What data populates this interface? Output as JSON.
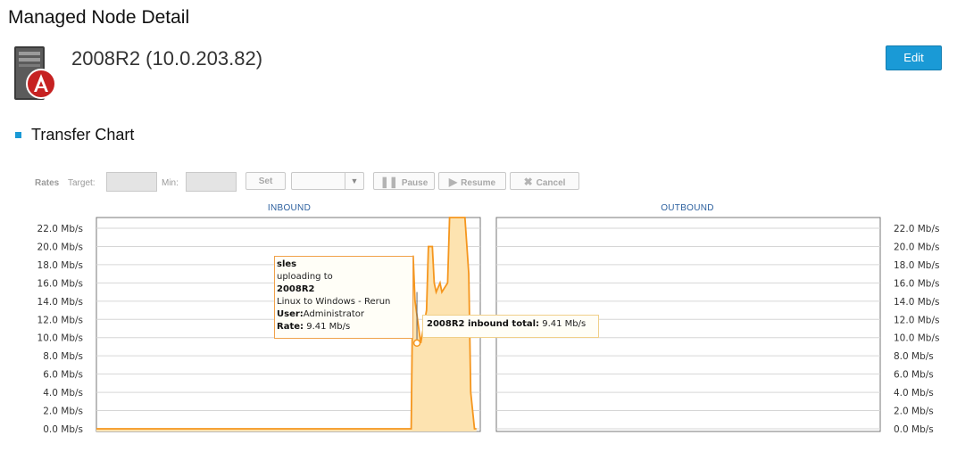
{
  "page": {
    "title": "Managed Node Detail"
  },
  "node": {
    "title": "2008R2 (10.0.203.82)",
    "icon": "server-node-icon"
  },
  "header": {
    "edit_label": "Edit"
  },
  "section": {
    "title": "Transfer Chart"
  },
  "toolbar": {
    "rates_label": "Rates",
    "target_label": "Target:",
    "target_value": "",
    "min_label": "Min:",
    "min_value": "",
    "set_label": "Set",
    "select_value": "",
    "pause_label": "Pause",
    "resume_label": "Resume",
    "cancel_label": "Cancel"
  },
  "panels": {
    "inbound_title": "INBOUND",
    "outbound_title": "OUTBOUND"
  },
  "colors": {
    "accent": "#1a9ad6",
    "series_line": "#f5961e",
    "series_fill": "#fde3b0"
  },
  "tooltip": {
    "user_name": "sles",
    "action": "uploading to",
    "target": "2008R2",
    "job": "Linux to Windows - Rerun",
    "user_label": "User:",
    "user_value": "Administrator",
    "rate_label": "Rate:",
    "rate_value": "9.41 Mb/s",
    "total_label": "2008R2 inbound total:",
    "total_value": "9.41 Mb/s"
  },
  "chart_data": [
    {
      "type": "area",
      "title": "INBOUND",
      "y_unit": "Mb/s",
      "ylim": [
        0,
        22
      ],
      "y_ticks": [
        "22.0 Mb/s",
        "20.0 Mb/s",
        "18.0 Mb/s",
        "16.0 Mb/s",
        "14.0 Mb/s",
        "12.0 Mb/s",
        "10.0 Mb/s",
        "8.0 Mb/s",
        "6.0 Mb/s",
        "4.0 Mb/s",
        "2.0 Mb/s",
        "0.0 Mb/s"
      ],
      "grid": true,
      "x": [
        0,
        0.78,
        0.82,
        0.825,
        0.83,
        0.845,
        0.86,
        0.865,
        0.875,
        0.88,
        0.885,
        0.895,
        0.9,
        0.915,
        0.92,
        0.93,
        0.955,
        0.96,
        0.97,
        0.975,
        0.985,
        0.99
      ],
      "values": [
        0,
        0,
        0,
        19,
        14,
        9.41,
        13,
        20,
        20,
        16,
        15,
        16,
        15,
        16,
        23.5,
        23.5,
        23.5,
        23.5,
        17,
        4,
        0,
        0
      ]
    },
    {
      "type": "area",
      "title": "OUTBOUND",
      "y_unit": "Mb/s",
      "ylim": [
        0,
        22
      ],
      "y_ticks": [
        "22.0 Mb/s",
        "20.0 Mb/s",
        "18.0 Mb/s",
        "16.0 Mb/s",
        "14.0 Mb/s",
        "12.0 Mb/s",
        "10.0 Mb/s",
        "8.0 Mb/s",
        "6.0 Mb/s",
        "4.0 Mb/s",
        "2.0 Mb/s",
        "0.0 Mb/s"
      ],
      "grid": true,
      "x": [],
      "values": []
    }
  ]
}
